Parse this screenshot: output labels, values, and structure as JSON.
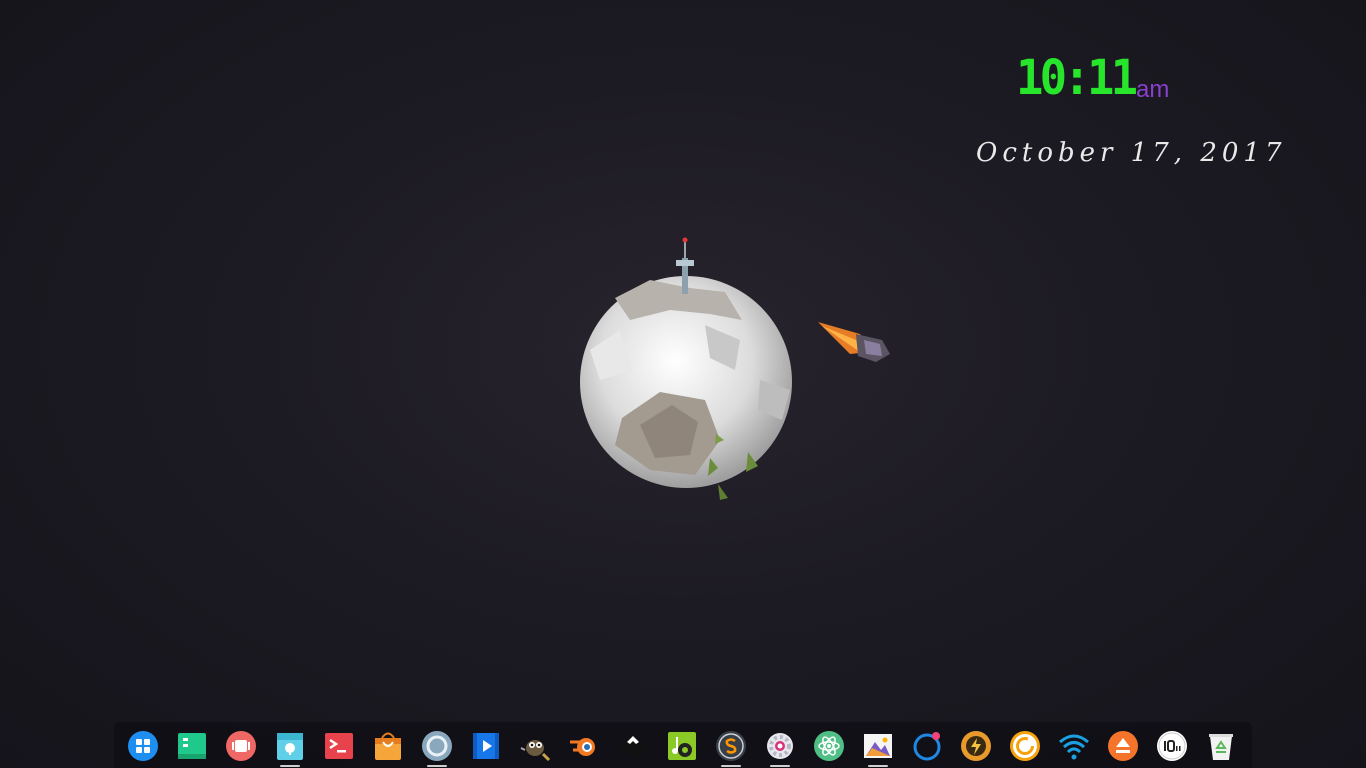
{
  "clock": {
    "time": "10:11",
    "ampm": "am"
  },
  "date": "October 17, 2017",
  "dock": {
    "items": [
      {
        "name": "launcher",
        "icon": "grid-icon"
      },
      {
        "name": "files",
        "icon": "green-window-icon"
      },
      {
        "name": "multitasking",
        "icon": "red-cards-icon"
      },
      {
        "name": "calendar",
        "icon": "calendar-icon",
        "running": true
      },
      {
        "name": "terminal",
        "icon": "terminal-icon"
      },
      {
        "name": "store",
        "icon": "shopping-bag-icon"
      },
      {
        "name": "browser",
        "icon": "circle-browser-icon",
        "running": true
      },
      {
        "name": "video",
        "icon": "video-play-icon"
      },
      {
        "name": "gimp",
        "icon": "gimp-icon"
      },
      {
        "name": "blender",
        "icon": "blender-icon"
      },
      {
        "name": "inkscape",
        "icon": "inkscape-icon"
      },
      {
        "name": "music",
        "icon": "music-icon"
      },
      {
        "name": "sublime",
        "icon": "sublime-s-icon",
        "running": true
      },
      {
        "name": "settings",
        "icon": "gear-icon",
        "running": true
      },
      {
        "name": "atom",
        "icon": "atom-icon"
      },
      {
        "name": "image-viewer",
        "icon": "photo-icon",
        "running": true
      },
      {
        "name": "activity",
        "icon": "ring-icon"
      },
      {
        "name": "power",
        "icon": "lightning-icon"
      },
      {
        "name": "crunchyroll",
        "icon": "c-ring-icon"
      },
      {
        "name": "network",
        "icon": "wifi-icon"
      },
      {
        "name": "eject",
        "icon": "eject-icon"
      },
      {
        "name": "clock",
        "icon": "clock-10-icon"
      },
      {
        "name": "trash",
        "icon": "recycle-bin-icon"
      }
    ]
  }
}
